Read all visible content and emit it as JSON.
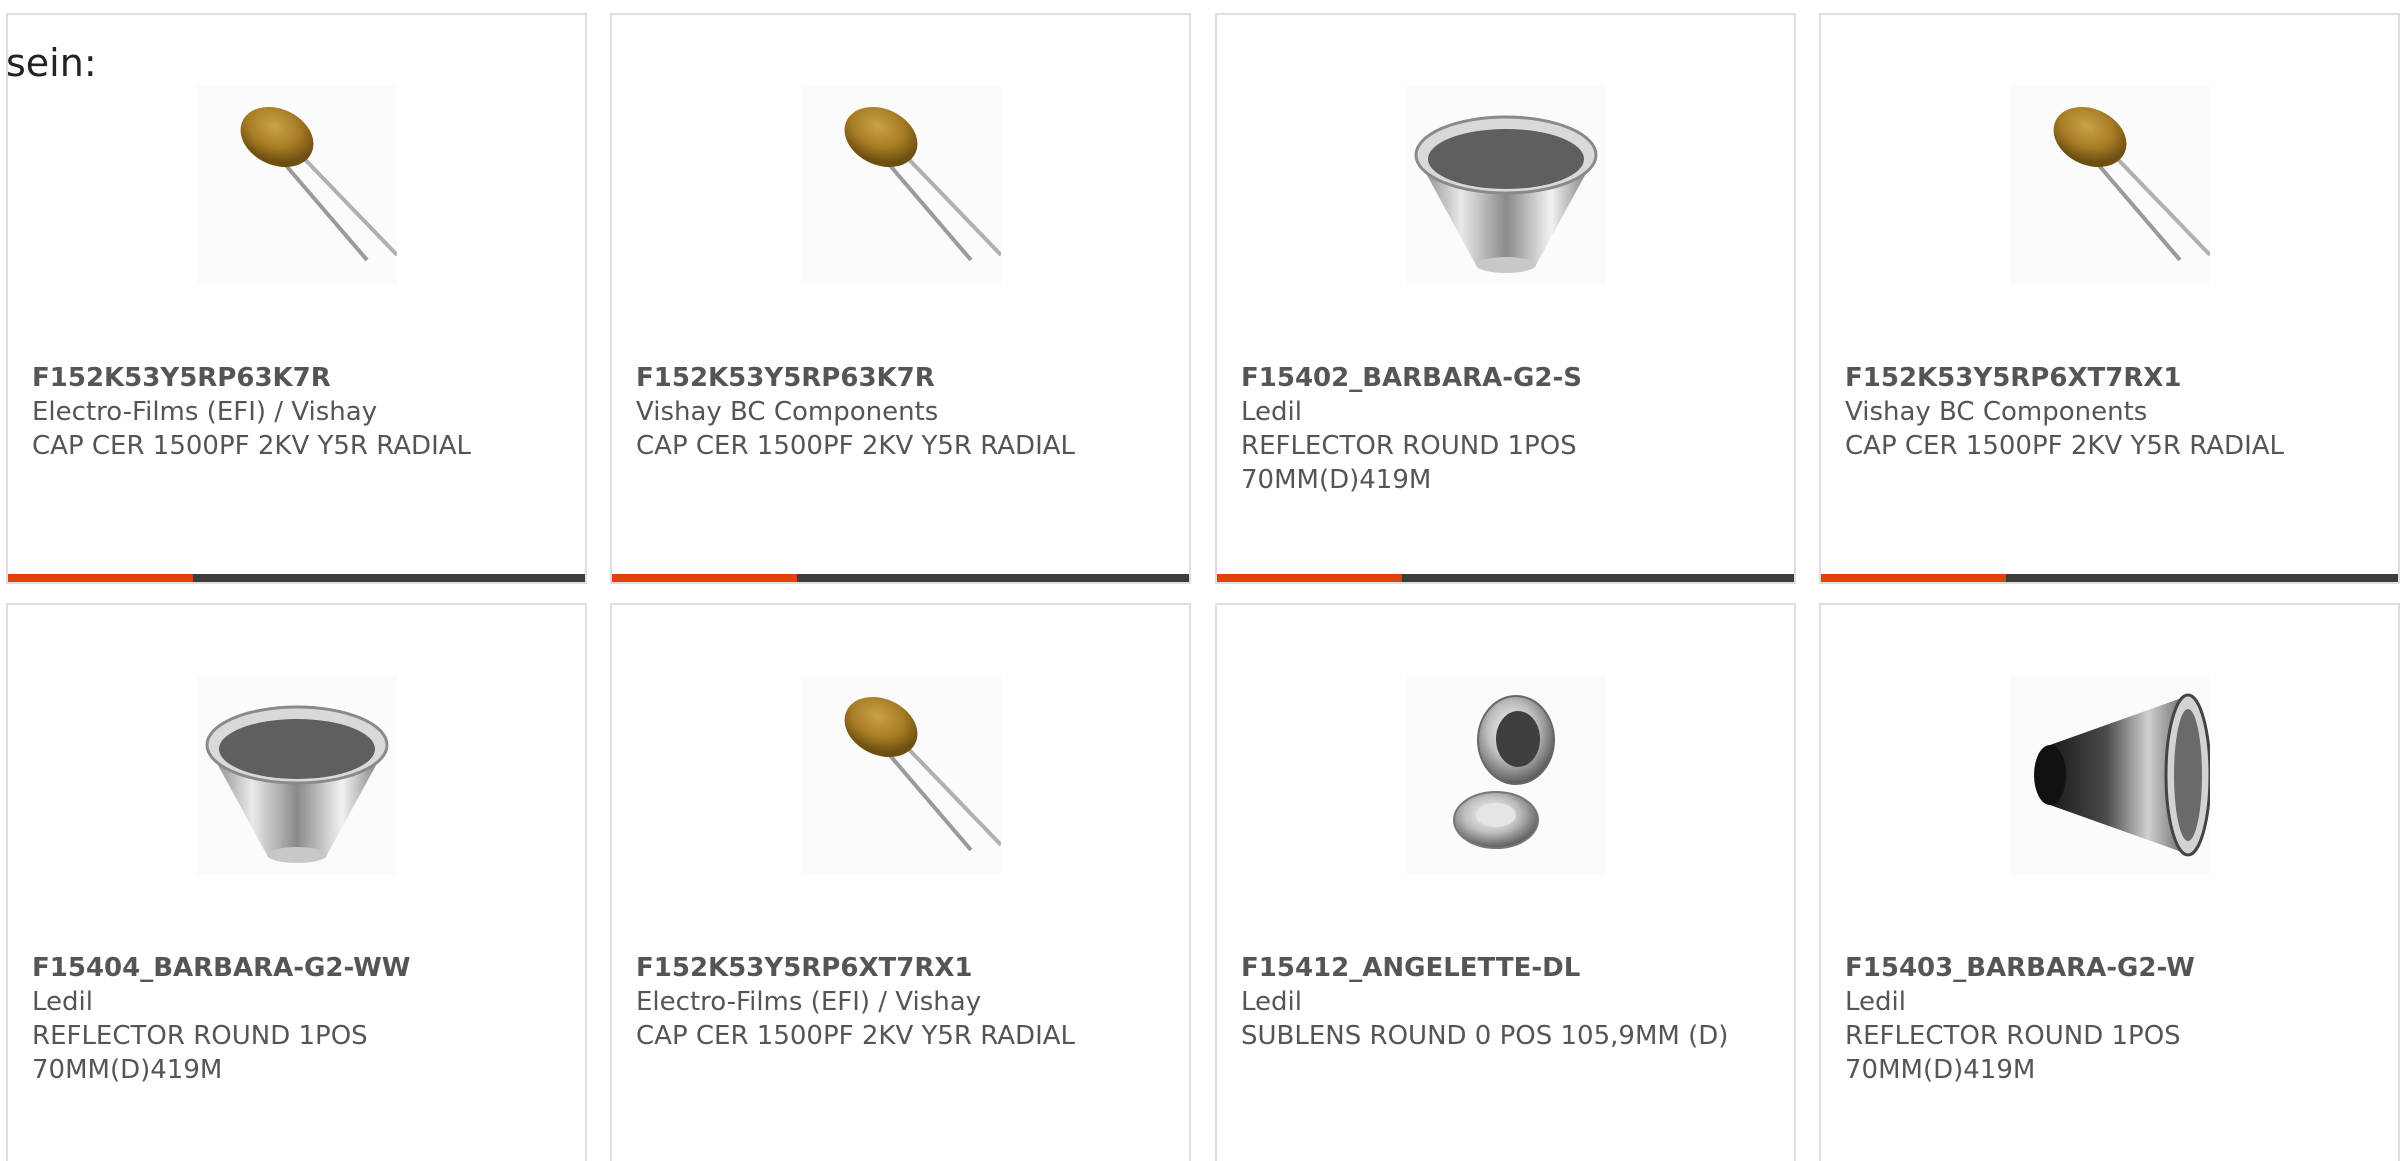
{
  "intro_text": "sein:",
  "colors": {
    "accent": "#e2410f",
    "bar_dark": "#3d3d3d",
    "text": "#555555",
    "border": "#dedede"
  },
  "products": [
    {
      "part_number": "F152K53Y5RP63K7R",
      "manufacturer": "Electro-Films (EFI) / Vishay",
      "description": "CAP CER 1500PF 2KV Y5R RADIAL",
      "image_icon": "ceramic-capacitor-icon",
      "has_progress_bar": true,
      "progress": 0.32
    },
    {
      "part_number": "F152K53Y5RP63K7R",
      "manufacturer": "Vishay BC Components",
      "description": "CAP CER 1500PF 2KV Y5R RADIAL",
      "image_icon": "ceramic-capacitor-icon",
      "has_progress_bar": true,
      "progress": 0.32
    },
    {
      "part_number": "F15402_BARBARA-G2-S",
      "manufacturer": "Ledil",
      "description": "REFLECTOR ROUND 1POS 70MM(D)419M",
      "image_icon": "reflector-icon",
      "has_progress_bar": true,
      "progress": 0.32
    },
    {
      "part_number": "F152K53Y5RP6XT7RX1",
      "manufacturer": "Vishay BC Components",
      "description": "CAP CER 1500PF 2KV Y5R RADIAL",
      "image_icon": "ceramic-capacitor-icon",
      "has_progress_bar": true,
      "progress": 0.32
    },
    {
      "part_number": "F15404_BARBARA-G2-WW",
      "manufacturer": "Ledil",
      "description": "REFLECTOR ROUND 1POS 70MM(D)419M",
      "image_icon": "reflector-icon",
      "has_progress_bar": false
    },
    {
      "part_number": "F152K53Y5RP6XT7RX1",
      "manufacturer": "Electro-Films (EFI) / Vishay",
      "description": "CAP CER 1500PF 2KV Y5R RADIAL",
      "image_icon": "ceramic-capacitor-icon",
      "has_progress_bar": false
    },
    {
      "part_number": "F15412_ANGELETTE-DL",
      "manufacturer": "Ledil",
      "description": "SUBLENS ROUND 0 POS 105,9MM (D)",
      "image_icon": "sublens-icon",
      "has_progress_bar": false
    },
    {
      "part_number": "F15403_BARBARA-G2-W",
      "manufacturer": "Ledil",
      "description": "REFLECTOR ROUND 1POS 70MM(D)419M",
      "image_icon": "black-reflector-icon",
      "has_progress_bar": false
    }
  ]
}
